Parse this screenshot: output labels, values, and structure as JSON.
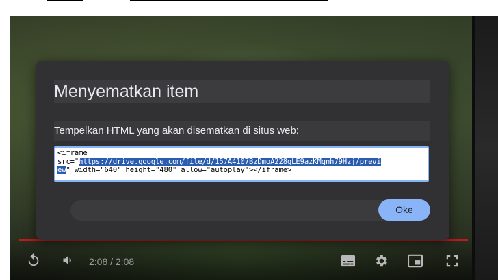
{
  "dialog": {
    "title": "Menyematkan item",
    "subtitle": "Tempelkan HTML yang akan disematkan di situs web:",
    "code": {
      "line1": "<iframe",
      "line2_prefix": "src=\"",
      "line2_selected": "https://drive.google.com/file/d/157A4107BzDmoA228gLE9azKMgnh79Hzj/previ",
      "line3_selected": "ew",
      "line3_rest": "\" width=\"640\" height=\"480\" allow=\"autoplay\"></iframe>"
    },
    "ok_label": "Oke"
  },
  "player": {
    "time": "2:08 / 2:08",
    "icons": [
      "replay-icon",
      "volume-icon",
      "subtitles-icon",
      "settings-icon",
      "miniplayer-icon",
      "fullscreen-icon"
    ]
  },
  "colors": {
    "accent": "#8ab4f8",
    "dialog_bg": "#313134",
    "progress": "#c2181e",
    "selection": "#2a5db0"
  }
}
